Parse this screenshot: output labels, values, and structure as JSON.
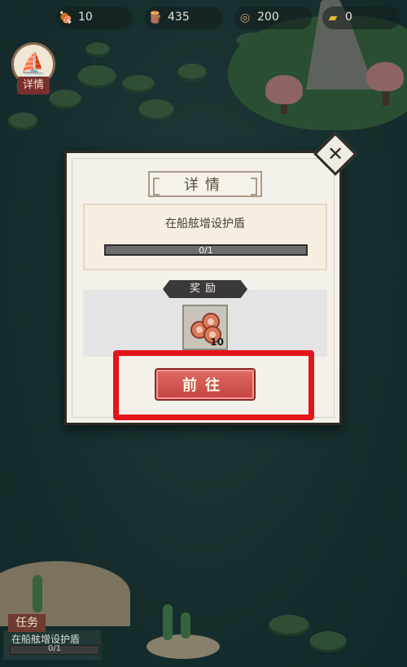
{
  "resources": [
    {
      "icon": "meat-icon",
      "glyph": "🍖",
      "value": "10"
    },
    {
      "icon": "wood-icon",
      "glyph": "🪵",
      "value": "435"
    },
    {
      "icon": "coin-icon",
      "glyph": "◎",
      "value": "200"
    },
    {
      "icon": "gold-ingot-icon",
      "glyph": "▰",
      "value": "0"
    }
  ],
  "side_button": {
    "label": "详情",
    "icon": "ship-icon"
  },
  "modal": {
    "title": "详情",
    "task_text": "在船舷增设护盾",
    "progress_text": "0/1",
    "progress_value": 0,
    "reward_label": "奖励",
    "reward_item": {
      "icon": "meat-icon",
      "count": "10"
    },
    "go_button": "前往"
  },
  "task_widget": {
    "tag": "任务",
    "text": "在船舷增设护盾",
    "progress_text": "0/1"
  },
  "colors": {
    "highlight": "#e4141b",
    "go_button": "#d4534d",
    "water": "#1f3b3a"
  }
}
